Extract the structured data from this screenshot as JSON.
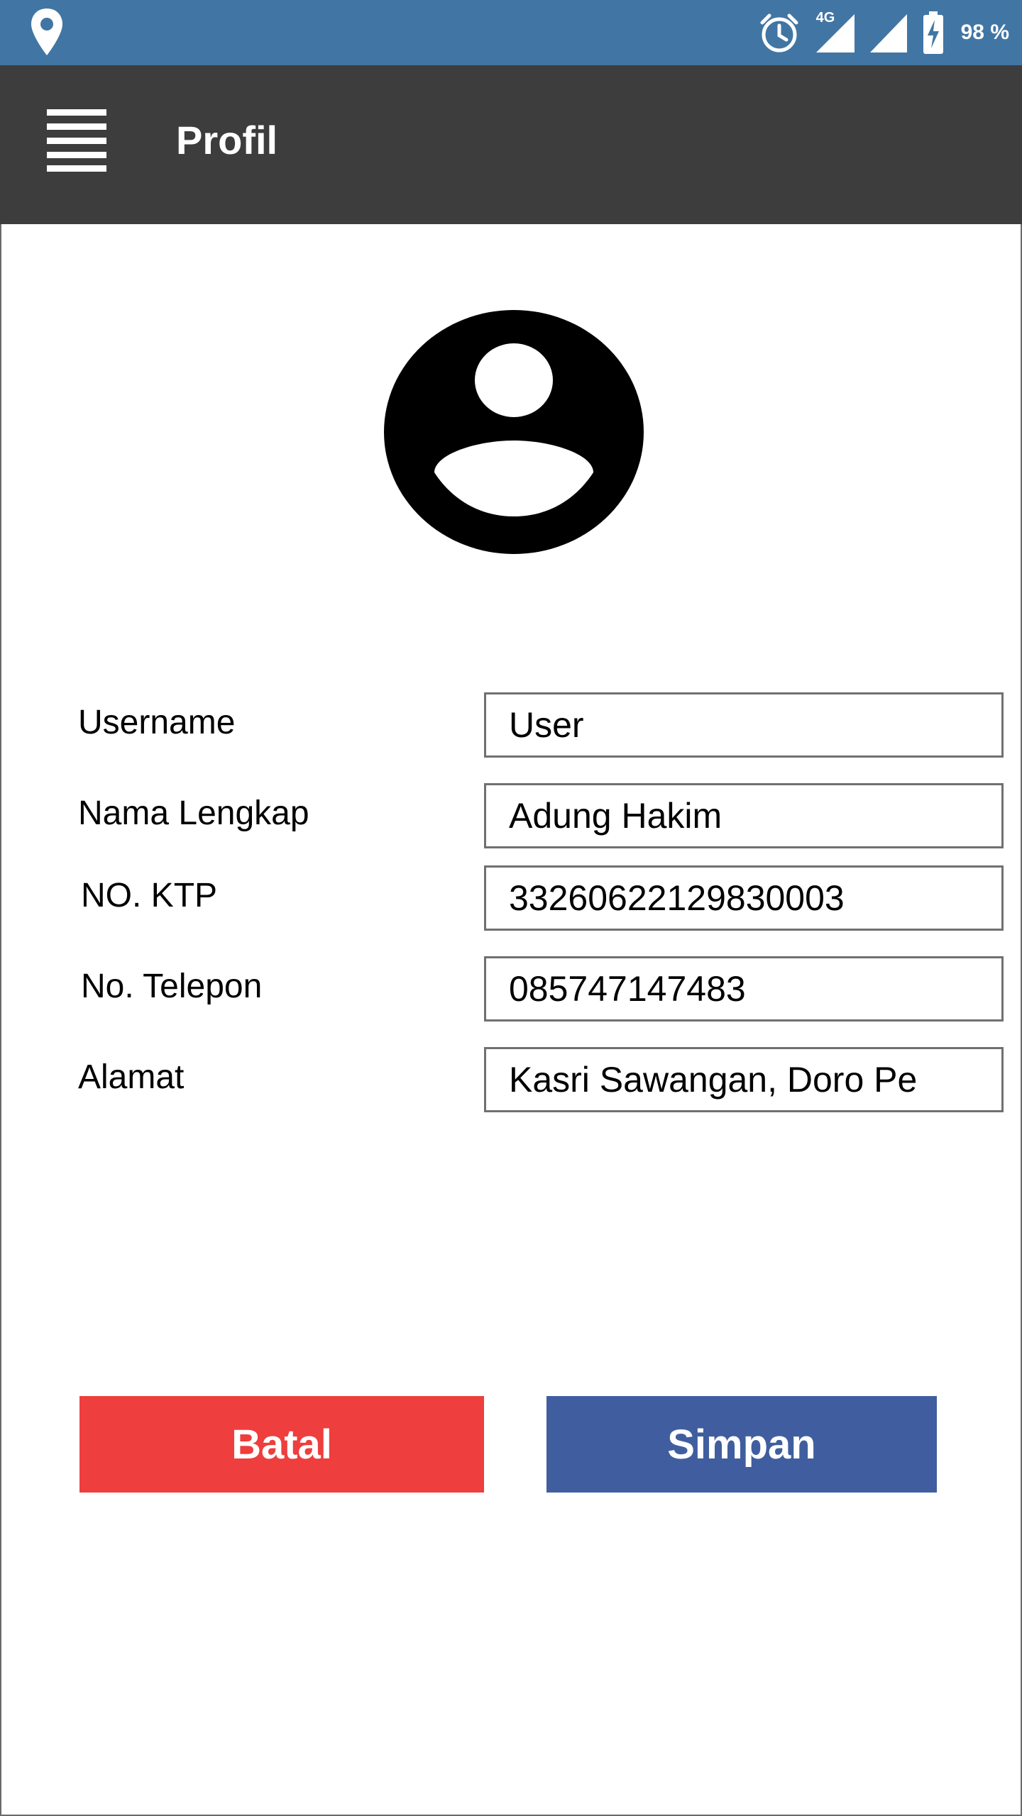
{
  "status_bar": {
    "battery_percent": "98 %",
    "network_type": "4G",
    "icons": [
      "location-pin-icon",
      "alarm-clock-icon",
      "signal-4g-icon",
      "signal-icon",
      "battery-charging-icon"
    ],
    "background_color": "#4176a4"
  },
  "app_bar": {
    "title": "Profil",
    "menu_icon": "hamburger-menu-icon",
    "background_color": "#3d3d3d"
  },
  "profile": {
    "avatar_icon": "user-avatar-icon"
  },
  "form": {
    "fields": [
      {
        "label": "Username",
        "value": "User"
      },
      {
        "label": "Nama Lengkap",
        "value": "Adung Hakim"
      },
      {
        "label": "NO. KTP",
        "value": "33260622129830003"
      },
      {
        "label": "No. Telepon",
        "value": "085747147483"
      },
      {
        "label": "Alamat",
        "value": "Kasri Sawangan, Doro Pe"
      }
    ]
  },
  "actions": {
    "cancel_label": "Batal",
    "save_label": "Simpan",
    "cancel_color": "#ee3e3e",
    "save_color": "#405e9f"
  }
}
